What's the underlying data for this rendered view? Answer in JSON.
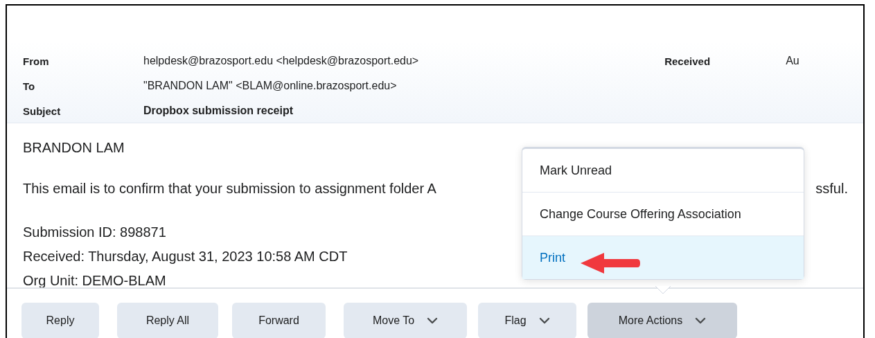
{
  "header": {
    "fields": [
      {
        "label": "From",
        "value": "helpdesk@brazosport.edu <helpdesk@brazosport.edu>",
        "bold": false
      },
      {
        "label": "To",
        "value": "\"BRANDON LAM\" <BLAM@online.brazosport.edu>",
        "bold": false
      },
      {
        "label": "Subject",
        "value": "Dropbox submission receipt",
        "bold": true
      }
    ],
    "received": {
      "label": "Received",
      "value": "Au"
    }
  },
  "body": {
    "greeting": "BRANDON LAM",
    "line": {
      "text": "This email is to confirm that your submission to assignment folder A",
      "tail": "ssful."
    },
    "details": [
      "Submission ID: 898871",
      "Received: Thursday, August 31, 2023 10:58 AM CDT",
      "Org Unit: DEMO-BLAM"
    ]
  },
  "toolbar": [
    {
      "label": "Reply",
      "dropdown": false,
      "selected": false
    },
    {
      "label": "Reply All",
      "dropdown": false,
      "selected": false
    },
    {
      "label": "Forward",
      "dropdown": false,
      "selected": false
    },
    {
      "label": "Move To",
      "dropdown": true,
      "selected": false
    },
    {
      "label": "Flag",
      "dropdown": true,
      "selected": false
    },
    {
      "label": "More Actions",
      "dropdown": true,
      "selected": true
    }
  ],
  "menu": [
    {
      "label": "Mark Unread",
      "selected": false
    },
    {
      "label": "Change Course Offering Association",
      "selected": false
    },
    {
      "label": "Print",
      "selected": true
    }
  ]
}
